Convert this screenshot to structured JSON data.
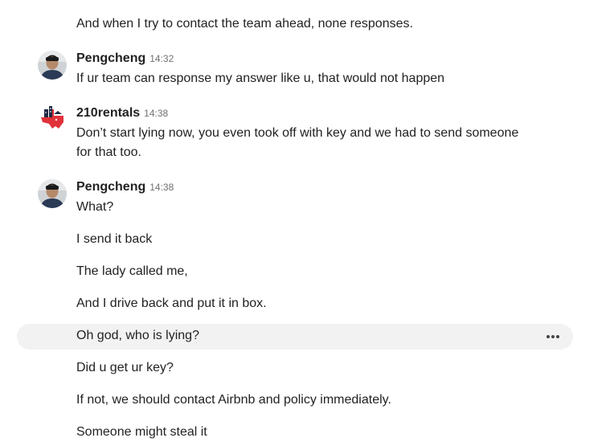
{
  "messages": {
    "m0": {
      "text": "And when I try to contact the team ahead, none responses."
    },
    "m1": {
      "sender": "Pengcheng",
      "time": "14:32",
      "lines": [
        "If ur team can response my answer like u, that would not happen"
      ]
    },
    "m2": {
      "sender": "210rentals",
      "time": "14:38",
      "lines": [
        "Don’t start lying now, you even took off with key and we had to send someone",
        "for that too."
      ]
    },
    "m3": {
      "sender": "Pengcheng",
      "time": "14:38",
      "lines": [
        "What?",
        "I send it back",
        "The lady called me,",
        "And I drive back and put it in box.",
        "Oh god, who is lying?",
        "Did u get ur key?",
        "If not, we should contact Airbnb and policy immediately.",
        "Someone might steal it"
      ]
    }
  },
  "icons": {
    "more_actions": "more-horizontal-icon",
    "host_logo": "texas-house-logo",
    "user_avatar": "user-photo-avatar"
  },
  "colors": {
    "text": "#222222",
    "muted": "#717171",
    "hover_row": "#f2f2f2",
    "logo_red": "#e0323a",
    "logo_navy": "#1f2a44"
  }
}
